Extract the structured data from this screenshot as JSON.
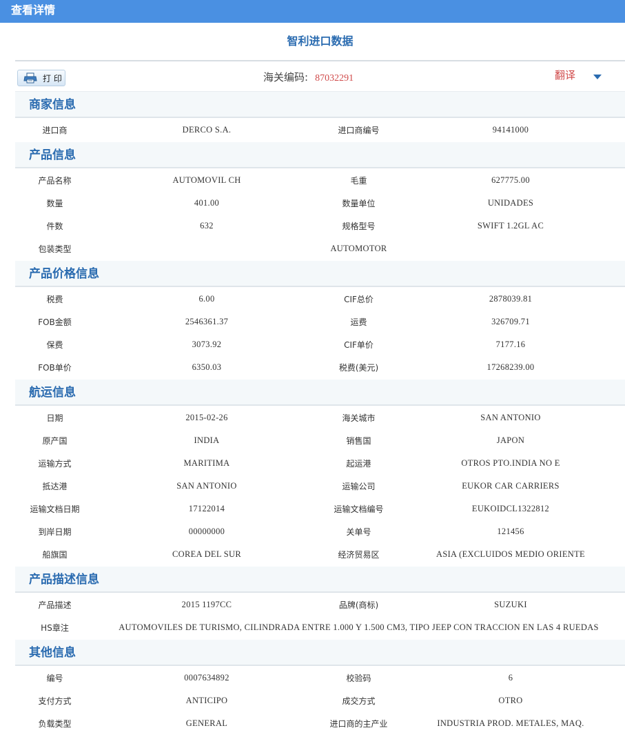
{
  "titlebar": "查看详情",
  "page_title": "智利进口数据",
  "toolbar": {
    "print_label": "打 印",
    "hs_label": "海关编码:",
    "hs_code": "87032291",
    "translate": "翻译"
  },
  "sections": [
    {
      "title": "商家信息",
      "rows": [
        [
          "进口商",
          "DERCO S.A.",
          "进口商编号",
          "94141000"
        ]
      ]
    },
    {
      "title": "产品信息",
      "rows": [
        [
          "产品名称",
          "AUTOMOVIL CH",
          "毛重",
          "627775.00"
        ],
        [
          "数量",
          "401.00",
          "数量单位",
          "UNIDADES"
        ],
        [
          "件数",
          "632",
          "规格型号",
          "SWIFT 1.2GL AC"
        ],
        [
          "包装类型",
          "",
          "AUTOMOTOR",
          ""
        ]
      ]
    },
    {
      "title": "产品价格信息",
      "rows": [
        [
          "税费",
          "6.00",
          "CIF总价",
          "2878039.81"
        ],
        [
          "FOB金额",
          "2546361.37",
          "运费",
          "326709.71"
        ],
        [
          "保费",
          "3073.92",
          "CIF单价",
          "7177.16"
        ],
        [
          "FOB单价",
          "6350.03",
          "税费(美元)",
          "17268239.00"
        ]
      ]
    },
    {
      "title": "航运信息",
      "rows": [
        [
          "日期",
          "2015-02-26",
          "海关城市",
          "SAN ANTONIO"
        ],
        [
          "原产国",
          "INDIA",
          "销售国",
          "JAPON"
        ],
        [
          "运输方式",
          "MARITIMA",
          "起运港",
          "OTROS PTO.INDIA NO E"
        ],
        [
          "抵达港",
          "SAN ANTONIO",
          "运输公司",
          "EUKOR CAR CARRIERS"
        ],
        [
          "运输文档日期",
          "17122014",
          "运输文档编号",
          "EUKOIDCL1322812"
        ],
        [
          "到岸日期",
          "00000000",
          "关单号",
          "121456"
        ],
        [
          "船旗国",
          "COREA DEL SUR",
          "经济贸易区",
          "ASIA (EXCLUIDOS MEDIO ORIENTE"
        ]
      ]
    },
    {
      "title": "产品描述信息",
      "rows": [
        [
          "产品描述",
          "2015 1197CC",
          "品牌(商标)",
          "SUZUKI"
        ]
      ],
      "span_row": [
        "HS章注",
        "AUTOMOVILES DE TURISMO, CILINDRADA ENTRE 1.000 Y 1.500 CM3, TIPO JEEP CON TRACCION EN LAS 4 RUEDAS"
      ]
    },
    {
      "title": "其他信息",
      "rows": [
        [
          "编号",
          "0007634892",
          "校验码",
          "6"
        ],
        [
          "支付方式",
          "ANTICIPO",
          "成交方式",
          "OTRO"
        ],
        [
          "负载类型",
          "GENERAL",
          "进口商的主产业",
          "INDUSTRIA PROD. METALES, MAQ."
        ]
      ]
    }
  ]
}
